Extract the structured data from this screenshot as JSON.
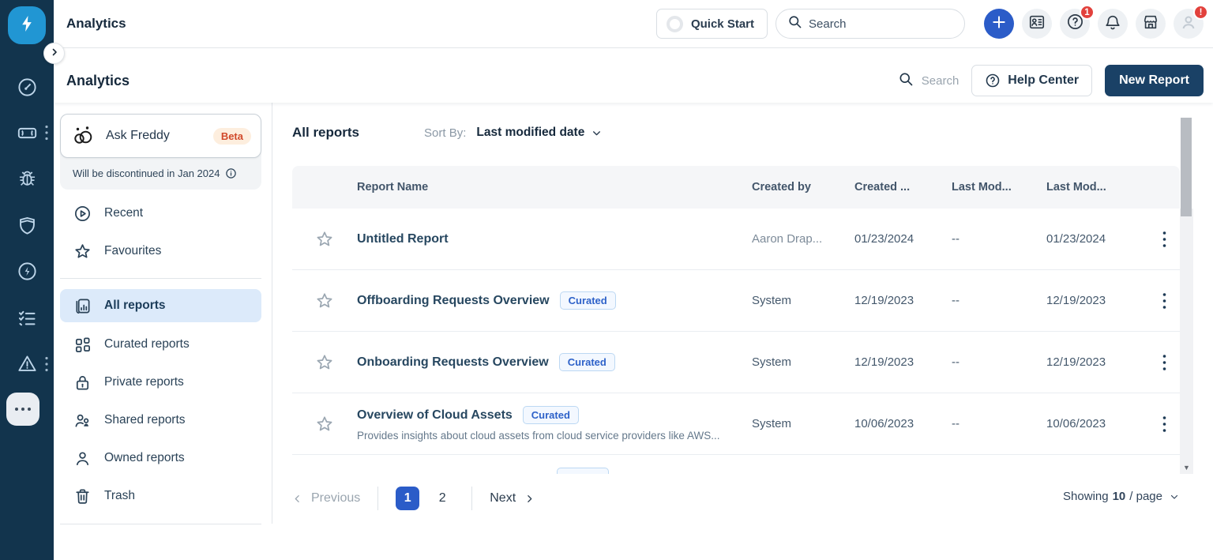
{
  "header": {
    "page_title": "Analytics",
    "quick_start_label": "Quick Start",
    "search_placeholder": "Search",
    "help_badge_count": "1",
    "profile_badge": "!"
  },
  "toolbar": {
    "title": "Analytics",
    "search_label": "Search",
    "help_center_label": "Help Center",
    "new_report_label": "New Report"
  },
  "rail": {
    "icons": [
      "bolt-logo",
      "gauge",
      "ticket",
      "bug",
      "shield",
      "lightning-circle",
      "checklist",
      "warning-triangle",
      "more-dots"
    ]
  },
  "left_panel": {
    "ask_freddy": {
      "label": "Ask Freddy",
      "beta_badge": "Beta",
      "notice": "Will be discontinued in Jan 2024"
    },
    "items": [
      {
        "label": "Recent"
      },
      {
        "label": "Favourites"
      },
      {
        "label": "All reports",
        "selected": true
      },
      {
        "label": "Curated reports"
      },
      {
        "label": "Private reports"
      },
      {
        "label": "Shared reports"
      },
      {
        "label": "Owned reports"
      },
      {
        "label": "Trash"
      }
    ]
  },
  "main": {
    "title": "All reports",
    "sort_by_label": "Sort By:",
    "sort_value": "Last modified date",
    "table": {
      "columns": {
        "name": "Report Name",
        "created_by": "Created by",
        "created": "Created ...",
        "last_mod_by": "Last Mod...",
        "last_mod": "Last Mod..."
      },
      "rows": [
        {
          "name": "Untitled Report",
          "badge": "",
          "description": "",
          "created_by": "Aaron Drap...",
          "created": "01/23/2024",
          "last_mod_by": "--",
          "last_mod": "01/23/2024"
        },
        {
          "name": "Offboarding Requests Overview",
          "badge": "Curated",
          "description": "",
          "created_by": "System",
          "created": "12/19/2023",
          "last_mod_by": "--",
          "last_mod": "12/19/2023"
        },
        {
          "name": "Onboarding Requests Overview",
          "badge": "Curated",
          "description": "",
          "created_by": "System",
          "created": "12/19/2023",
          "last_mod_by": "--",
          "last_mod": "12/19/2023"
        },
        {
          "name": "Overview of Cloud Assets",
          "badge": "Curated",
          "description": "Provides insights about cloud assets from cloud service providers like AWS...",
          "created_by": "System",
          "created": "10/06/2023",
          "last_mod_by": "--",
          "last_mod": "10/06/2023"
        }
      ]
    },
    "pagination": {
      "previous_label": "Previous",
      "page_1": "1",
      "page_2": "2",
      "next_label": "Next",
      "showing_label": "Showing",
      "per_page_value": "10",
      "per_page_suffix": "/ page"
    }
  },
  "colors": {
    "rail_bg": "#12344d",
    "accent_blue": "#2b5cc8",
    "brand_dark_button": "#1a4166",
    "selected_nav_bg": "#dceafa",
    "badge_red": "#e2413c",
    "curated_blue": "#2e62c9",
    "beta_orange": "#d1492a"
  }
}
